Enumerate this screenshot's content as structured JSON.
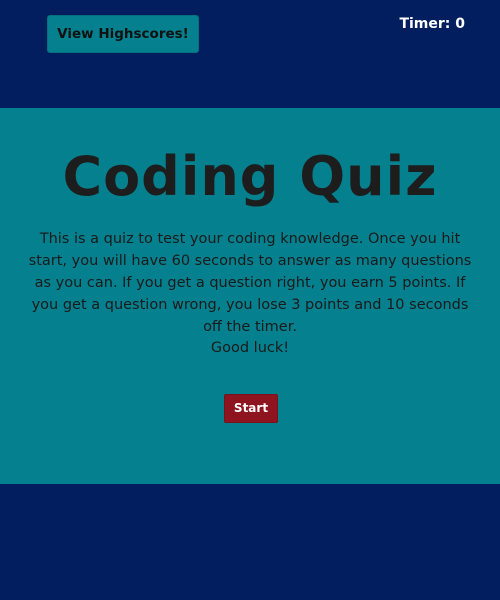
{
  "header": {
    "highscores_label": "View Highscores!",
    "timer_text": "Timer: 0"
  },
  "main": {
    "title": "Coding Quiz",
    "description": "This is a quiz to test your coding knowledge. Once you hit start, you will have 60 seconds to answer as many questions as you can. If you get a question right, you earn 5 points. If you get a question wrong, you lose 3 points and 10 seconds off the timer.",
    "good_luck": "Good luck!",
    "start_label": "Start"
  },
  "colors": {
    "background": "#021e5f",
    "panel": "#05808e",
    "start_button": "#8e1520",
    "text_dark": "#1a1a1a",
    "text_light": "#ffffff"
  }
}
